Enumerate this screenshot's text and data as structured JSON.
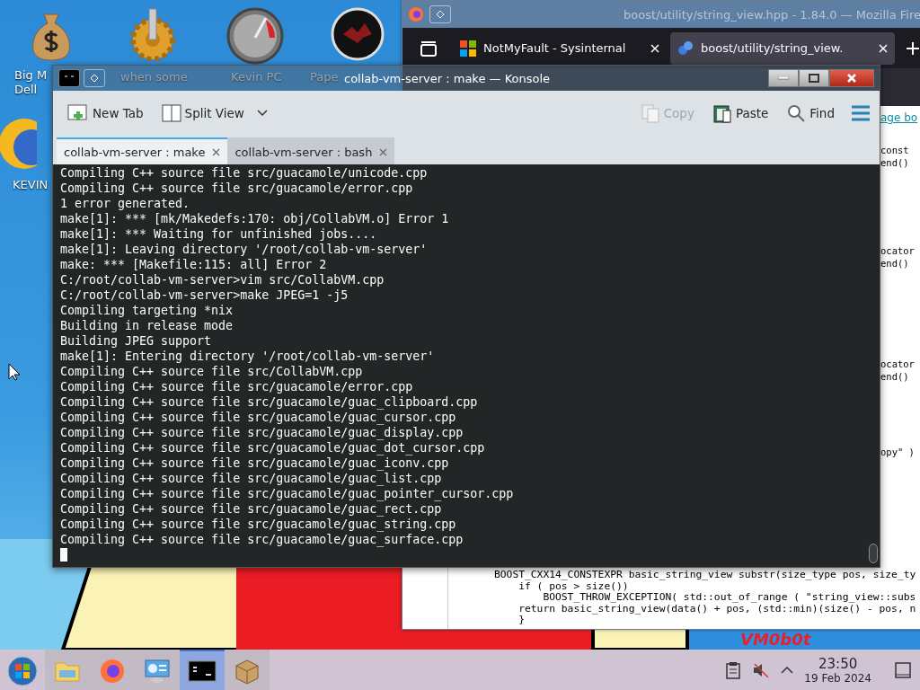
{
  "desktop": {
    "icons": [
      {
        "kind": "money-bag",
        "label_lines": [
          "Big M",
          "Dell"
        ]
      },
      {
        "kind": "gear",
        "label_lines": [
          "when some"
        ]
      },
      {
        "kind": "gauge",
        "label_lines": [
          "Kevin PC"
        ]
      },
      {
        "kind": "dark-disc",
        "label_lines": [
          "Pape"
        ]
      },
      {
        "kind": "sun-globe",
        "label_lines": [
          "KEVIN"
        ]
      }
    ],
    "wallpaper_text": "VM0b0t"
  },
  "firefox": {
    "title": "boost/utility/string_view.hpp - 1.84.0 — Mozilla Fire",
    "tabs": [
      {
        "label": "NotMyFault - Sysinternal",
        "selected": false
      },
      {
        "label": "boost/utility/string_view.",
        "selected": true
      }
    ],
    "link": "age bo",
    "code_right": [
      "const",
      "end()",
      "ocator",
      "end()",
      "ocator",
      "end()",
      "opy\" )"
    ],
    "code_bottom": [
      "BOOST_CXX14_CONSTEXPR basic_string_view substr(size_type pos, size_ty",
      "    if ( pos > size())",
      "        BOOST_THROW_EXCEPTION( std::out_of_range ( \"string_view::subs",
      "    return basic_string_view(data() + pos, (std::min)(size() - pos, n",
      "    }"
    ]
  },
  "konsole": {
    "title": "collab-vm-server : make — Konsole",
    "toolbar": [
      {
        "kind": "new-tab",
        "label": "New Tab",
        "disabled": false
      },
      {
        "kind": "split",
        "label": "Split View",
        "disabled": false
      },
      {
        "kind": "copy",
        "label": "Copy",
        "disabled": true
      },
      {
        "kind": "paste",
        "label": "Paste",
        "disabled": false
      },
      {
        "kind": "find",
        "label": "Find",
        "disabled": false
      }
    ],
    "tabs": [
      {
        "label": "collab-vm-server : make",
        "selected": true
      },
      {
        "label": "collab-vm-server : bash",
        "selected": false
      }
    ],
    "lines": [
      "Compiling C++ source file src/guacamole/unicode.cpp",
      "Compiling C++ source file src/guacamole/error.cpp",
      "1 error generated.",
      "make[1]: *** [mk/Makedefs:170: obj/CollabVM.o] Error 1",
      "make[1]: *** Waiting for unfinished jobs....",
      "make[1]: Leaving directory '/root/collab-vm-server'",
      "make: *** [Makefile:115: all] Error 2",
      "C:/root/collab-vm-server>vim src/CollabVM.cpp",
      "C:/root/collab-vm-server>make JPEG=1 -j5",
      "Compiling targeting *nix",
      "Building in release mode",
      "Building JPEG support",
      "make[1]: Entering directory '/root/collab-vm-server'",
      "Compiling C++ source file src/CollabVM.cpp",
      "Compiling C++ source file src/guacamole/error.cpp",
      "Compiling C++ source file src/guacamole/guac_clipboard.cpp",
      "Compiling C++ source file src/guacamole/guac_cursor.cpp",
      "Compiling C++ source file src/guacamole/guac_display.cpp",
      "Compiling C++ source file src/guacamole/guac_dot_cursor.cpp",
      "Compiling C++ source file src/guacamole/guac_iconv.cpp",
      "Compiling C++ source file src/guacamole/guac_list.cpp",
      "Compiling C++ source file src/guacamole/guac_pointer_cursor.cpp",
      "Compiling C++ source file src/guacamole/guac_rect.cpp",
      "Compiling C++ source file src/guacamole/guac_string.cpp",
      "Compiling C++ source file src/guacamole/guac_surface.cpp"
    ]
  },
  "taskbar": {
    "apps": [
      {
        "kind": "start",
        "selected": false
      },
      {
        "kind": "folder",
        "selected": false
      },
      {
        "kind": "firefox",
        "selected": false
      },
      {
        "kind": "network",
        "selected": false
      },
      {
        "kind": "terminal",
        "selected": true
      },
      {
        "kind": "package",
        "selected": false
      }
    ],
    "muted": true,
    "time": "23:50",
    "date": "19 Feb 2024"
  }
}
